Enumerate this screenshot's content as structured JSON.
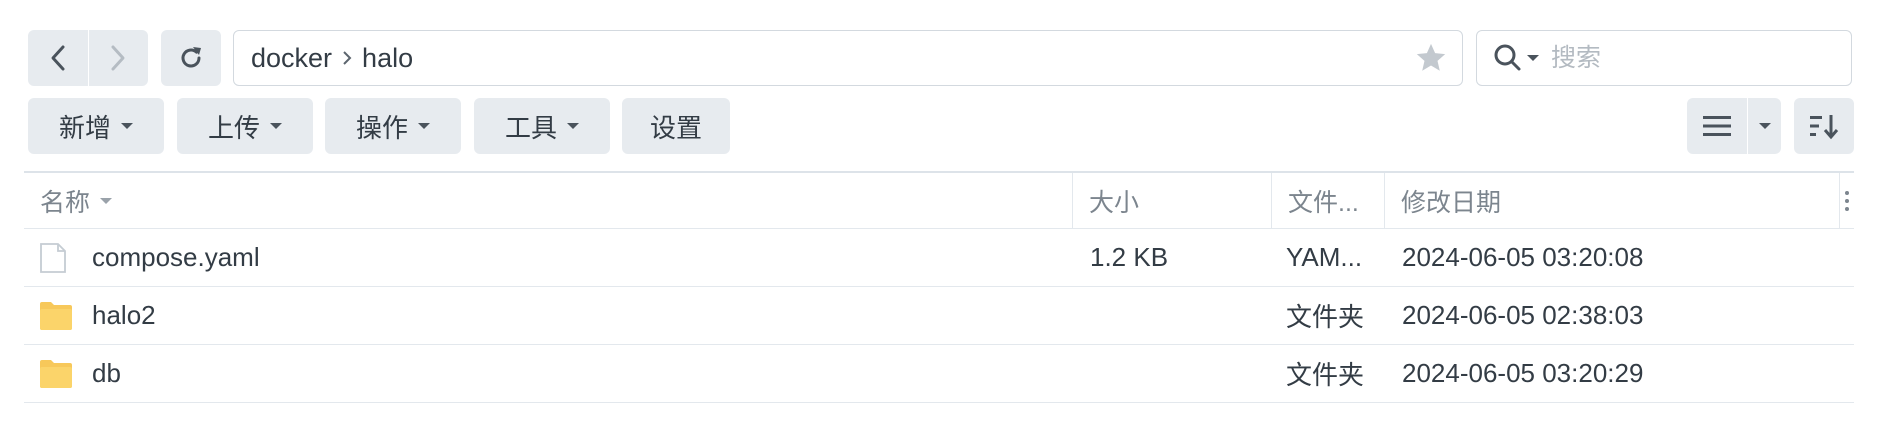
{
  "nav": {
    "back_icon": "chevron-left-icon",
    "forward_icon": "chevron-right-icon",
    "refresh_icon": "refresh-icon"
  },
  "path": {
    "segments": [
      "docker",
      "halo"
    ],
    "favorite_icon": "star-icon"
  },
  "search": {
    "placeholder": "搜索",
    "value": ""
  },
  "toolbar": {
    "buttons": [
      {
        "label": "新增",
        "has_dropdown": true
      },
      {
        "label": "上传",
        "has_dropdown": true
      },
      {
        "label": "操作",
        "has_dropdown": true
      },
      {
        "label": "工具",
        "has_dropdown": true
      },
      {
        "label": "设置",
        "has_dropdown": false
      }
    ],
    "view_icon": "list-view-icon",
    "sort_icon": "sort-icon"
  },
  "table": {
    "columns": [
      "名称",
      "大小",
      "文件...",
      "修改日期"
    ],
    "rows": [
      {
        "icon": "file-icon",
        "name": "compose.yaml",
        "size": "1.2 KB",
        "type": "YAM...",
        "modified": "2024-06-05 03:20:08"
      },
      {
        "icon": "folder-icon",
        "name": "halo2",
        "size": "",
        "type": "文件夹",
        "modified": "2024-06-05 02:38:03"
      },
      {
        "icon": "folder-icon",
        "name": "db",
        "size": "",
        "type": "文件夹",
        "modified": "2024-06-05 03:20:29"
      }
    ]
  },
  "colors": {
    "button_bg": "#e7ebef",
    "folder": "#f7c85a",
    "text": "#333c45",
    "muted": "#7c858e"
  }
}
